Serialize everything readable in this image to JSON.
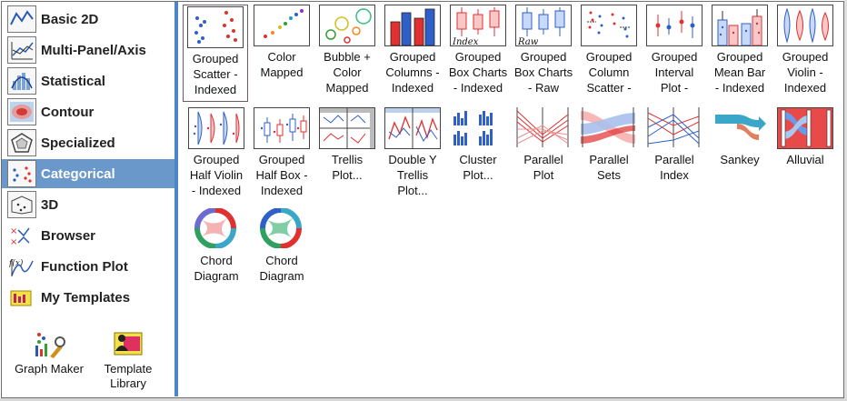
{
  "categories": [
    {
      "label": "Basic 2D",
      "icon": "basic-2d-icon"
    },
    {
      "label": "Multi-Panel/Axis",
      "icon": "multi-panel-icon"
    },
    {
      "label": "Statistical",
      "icon": "statistical-icon"
    },
    {
      "label": "Contour",
      "icon": "contour-icon"
    },
    {
      "label": "Specialized",
      "icon": "specialized-icon"
    },
    {
      "label": "Categorical",
      "icon": "categorical-icon",
      "active": true
    },
    {
      "label": "3D",
      "icon": "3d-icon"
    },
    {
      "label": "Browser",
      "icon": "browser-icon"
    },
    {
      "label": "Function Plot",
      "icon": "function-plot-icon"
    },
    {
      "label": "My Templates",
      "icon": "my-templates-icon"
    }
  ],
  "bottom_buttons": [
    {
      "label": "Graph Maker",
      "icon": "graph-maker-icon"
    },
    {
      "label": "Template\nLibrary",
      "icon": "template-library-icon"
    }
  ],
  "templates": [
    {
      "label": "Grouped\nScatter -\nIndexed",
      "icon": "grouped-scatter-indexed-icon",
      "selected": true
    },
    {
      "label": "Color\nMapped",
      "icon": "color-mapped-icon"
    },
    {
      "label": "Bubble +\nColor\nMapped",
      "icon": "bubble-color-mapped-icon"
    },
    {
      "label": "Grouped\nColumns -\nIndexed",
      "icon": "grouped-columns-indexed-icon"
    },
    {
      "label": "Grouped\nBox Charts\n- Indexed",
      "icon": "grouped-box-indexed-icon",
      "thumb_text": "Index"
    },
    {
      "label": "Grouped\nBox Charts\n- Raw",
      "icon": "grouped-box-raw-icon",
      "thumb_text": "Raw"
    },
    {
      "label": "Grouped\nColumn\nScatter -",
      "icon": "grouped-column-scatter-icon"
    },
    {
      "label": "Grouped\nInterval\nPlot -",
      "icon": "grouped-interval-icon"
    },
    {
      "label": "Grouped\nMean Bar\n- Indexed",
      "icon": "grouped-mean-bar-icon"
    },
    {
      "label": "Grouped\nViolin -\nIndexed",
      "icon": "grouped-violin-icon"
    },
    {
      "label": "Grouped\nHalf Violin\n- Indexed",
      "icon": "grouped-half-violin-icon"
    },
    {
      "label": "Grouped\nHalf Box -\nIndexed",
      "icon": "grouped-half-box-icon"
    },
    {
      "label": "Trellis\nPlot...",
      "icon": "trellis-plot-icon"
    },
    {
      "label": "Double Y\nTrellis\nPlot...",
      "icon": "double-y-trellis-icon"
    },
    {
      "label": "Cluster\nPlot...",
      "icon": "cluster-plot-icon"
    },
    {
      "label": "Parallel\nPlot",
      "icon": "parallel-plot-icon"
    },
    {
      "label": "Parallel\nSets",
      "icon": "parallel-sets-icon"
    },
    {
      "label": "Parallel\nIndex",
      "icon": "parallel-index-icon"
    },
    {
      "label": "Sankey",
      "icon": "sankey-icon"
    },
    {
      "label": "Alluvial",
      "icon": "alluvial-icon"
    },
    {
      "label": "Chord\nDiagram",
      "icon": "chord-diagram-icon"
    },
    {
      "label": "Chord\nDiagram",
      "icon": "chord-diagram-icon"
    }
  ],
  "colors": {
    "accent": "#6a98cb",
    "divider": "#4a86c8",
    "red": "#e03030",
    "blue": "#2f5fc8"
  }
}
